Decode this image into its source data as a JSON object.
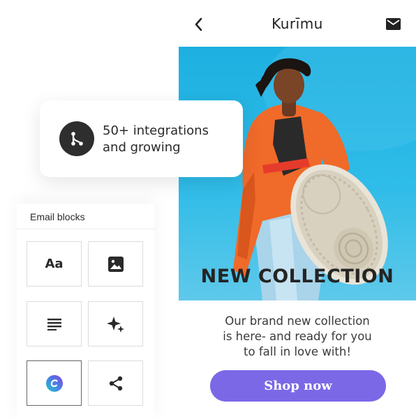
{
  "email_preview": {
    "brand": "Kurīmu",
    "hero_title": "NEW COLLECTION",
    "body_lines": [
      "Our brand new collection",
      "is here- and ready for you",
      "to fall in love with!"
    ],
    "cta_label": "Shop now",
    "icons": {
      "back": "chevron-left-icon",
      "mail": "mail-icon"
    }
  },
  "integrations": {
    "lines": [
      "50+ integrations",
      "and growing"
    ],
    "icon": "branch-icon"
  },
  "blocks_panel": {
    "title": "Email blocks",
    "tiles": [
      {
        "name": "text-block",
        "glyph": "Aa",
        "icon": "text-icon"
      },
      {
        "name": "image-block",
        "icon": "image-icon"
      },
      {
        "name": "paragraph-block",
        "icon": "paragraph-icon"
      },
      {
        "name": "ai-block",
        "icon": "sparkle-icon"
      },
      {
        "name": "canva-block",
        "icon": "canva-icon",
        "selected": true
      },
      {
        "name": "social-block",
        "icon": "share-icon"
      }
    ]
  },
  "colors": {
    "cta": "#7b68e6",
    "hero_sky": "#2fbce8",
    "jacket": "#f06a2a",
    "dark": "#2e2e2e"
  }
}
